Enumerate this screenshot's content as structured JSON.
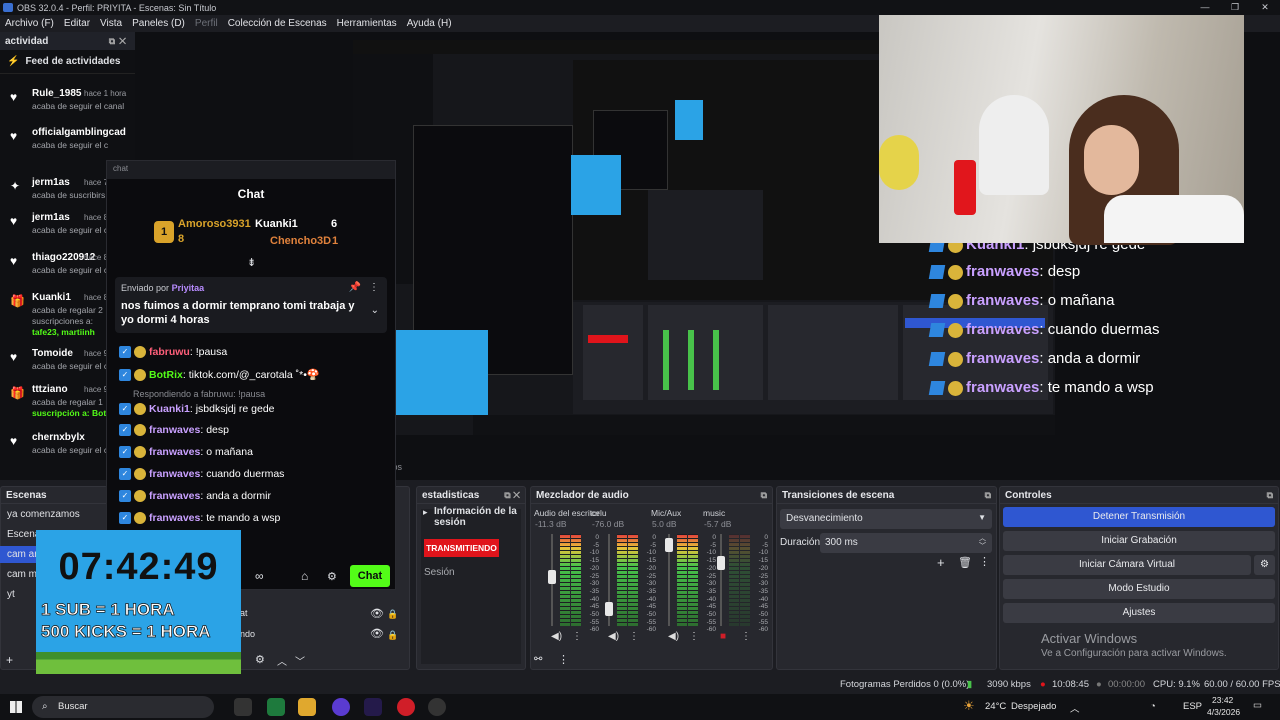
{
  "window": {
    "title": "OBS 32.0.4 - Perfil: PRIYITA - Escenas: Sin Título"
  },
  "menu": [
    "Archivo (F)",
    "Editar",
    "Vista",
    "Paneles (D)",
    "Perfil",
    "Colección de Escenas",
    "Herramientas",
    "Ayuda (H)"
  ],
  "feed": {
    "dock_title": "actividad",
    "title": "Feed de actividades",
    "items": [
      {
        "name": "Rule_1985",
        "time": "hace 1 hora",
        "desc": "acaba de seguir el canal",
        "icon": "heart-icon"
      },
      {
        "name": "officialgamblingcad",
        "time": "",
        "desc": "acaba de seguir el c",
        "icon": "heart-icon"
      },
      {
        "name": "jerm1as",
        "time": "hace 7",
        "desc": "acaba de suscribirs",
        "icon": "sparkle-icon"
      },
      {
        "name": "jerm1as",
        "time": "hace 8",
        "desc": "acaba de seguir el c",
        "icon": "heart-icon"
      },
      {
        "name": "thiago220912",
        "time": "hace 8",
        "desc": "acaba de seguir el c",
        "icon": "heart-icon"
      },
      {
        "name": "Kuanki1",
        "time": "hace 8",
        "desc": "acaba de regalar 2|suscripciones a:|tafe23, martiinh",
        "icon": "gift-icon"
      },
      {
        "name": "Tomoide",
        "time": "hace 9",
        "desc": "acaba de seguir el c",
        "icon": "heart-icon"
      },
      {
        "name": "tttziano",
        "time": "hace 9",
        "desc": "acaba de regalar 1|suscripción a: BotR",
        "icon": "gift-icon"
      },
      {
        "name": "chernxbylx",
        "time": "",
        "desc": "acaba de seguir el c",
        "icon": "heart-icon"
      }
    ]
  },
  "chat": {
    "window_label": "chat",
    "title": "Chat",
    "leaderboard": [
      {
        "name": "Amoroso3931",
        "value": "8",
        "color": "#d9a32a"
      },
      {
        "name": "Kuanki1",
        "value": "6",
        "color": "#ffffff"
      },
      {
        "name": "Chencho3D",
        "value": "1",
        "color": "#e0823c"
      }
    ],
    "pinned": {
      "by_label": "Enviado por",
      "by_user": "Priyitaa",
      "message": "nos fuimos a dormir temprano tomi trabaja y yo dormi 4 horas"
    },
    "messages": [
      {
        "user": "fabruwu",
        "text": "!pausa",
        "ucls": "r"
      },
      {
        "user": "BotRix",
        "text": "tiktok.com/@_carotala ˚*•🍄",
        "ucls": "gr"
      },
      {
        "user": "",
        "text": "Respondiendo a fabruwu: !pausa",
        "ucls": "reply"
      },
      {
        "user": "Kuanki1",
        "text": "jsbdksjdj re gede",
        "ucls": "v"
      },
      {
        "user": "franwaves",
        "text": "desp",
        "ucls": "v"
      },
      {
        "user": "franwaves",
        "text": "o mañana",
        "ucls": "v"
      },
      {
        "user": "franwaves",
        "text": "cuando duermas",
        "ucls": "v"
      },
      {
        "user": "franwaves",
        "text": "anda a dormir",
        "ucls": "v"
      },
      {
        "user": "franwaves",
        "text": "te mando a wsp",
        "ucls": "v"
      }
    ],
    "send_label": "Chat"
  },
  "overlay": {
    "clock": "07:42:49",
    "line1": "1 SUB = 1 HORA",
    "line2": "500 KICKS = 1 HORA",
    "big_chat": [
      {
        "user": "Kuanki1",
        "text": "jsbdksjdj re gede"
      },
      {
        "user": "franwaves",
        "text": "te mando a wsp"
      },
      {
        "user": "franwaves",
        "text": "desp"
      },
      {
        "user": "franwaves",
        "text": "o mañana"
      },
      {
        "user": "franwaves",
        "text": "cuando duermas"
      },
      {
        "user": "franwaves",
        "text": "anda a dormir"
      },
      {
        "user": "franwaves",
        "text": "te mando a wsp"
      }
    ]
  },
  "partial_tab": "ltros",
  "scenes": {
    "title": "Escenas",
    "items": [
      "ya comenzamos",
      "Escena",
      "cam ar",
      "cam m",
      "yt"
    ]
  },
  "sources": {
    "items": [
      "at",
      "ndo"
    ]
  },
  "stats": {
    "title": "estadisticas",
    "info": "Información de la sesión",
    "badge": "TRANSMITIENDO",
    "session": "Sesión"
  },
  "mixer": {
    "title": "Mezclador de audio",
    "channels": [
      {
        "name": "Audio del escritorio",
        "db": "-11.3 dB",
        "level": 0.55
      },
      {
        "name": "celu",
        "db": "-76.0 dB",
        "level": 0.15
      },
      {
        "name": "Mic/Aux",
        "db": "5.0 dB",
        "level": 0.95
      },
      {
        "name": "music",
        "db": "-5.7 dB",
        "level": 0.72
      }
    ],
    "scale": [
      "0",
      "-5",
      "-10",
      "-15",
      "-20",
      "-25",
      "-30",
      "-35",
      "-40",
      "-45",
      "-50",
      "-55",
      "-60"
    ]
  },
  "transitions": {
    "title": "Transiciones de escena",
    "selected": "Desvanecimiento",
    "duration_label": "Duración",
    "duration": "300 ms"
  },
  "controls": {
    "title": "Controles",
    "buttons": [
      "Detener Transmisión",
      "Iniciar Grabación",
      "Iniciar Cámara Virtual",
      "Modo Estudio",
      "Ajustes"
    ]
  },
  "activate": {
    "title": "Activar Windows",
    "sub": "Ve a Configuración para activar Windows."
  },
  "status": {
    "dropped": "Fotogramas Perdidos 0 (0.0%)",
    "bitrate": "3090 kbps",
    "live": "10:08:45",
    "rec": "00:00:00",
    "cpu": "CPU: 9.1%",
    "fps": "60.00 / 60.00 FPS"
  },
  "taskbar": {
    "search": "Buscar",
    "weather_temp": "24°C",
    "weather": "Despejado",
    "lang": "ESP",
    "time": "23:42",
    "date": "4/3/2026"
  },
  "colors": {
    "accent": "#2f57d1",
    "kick_green": "#53fc18",
    "live_red": "#e0141b"
  }
}
